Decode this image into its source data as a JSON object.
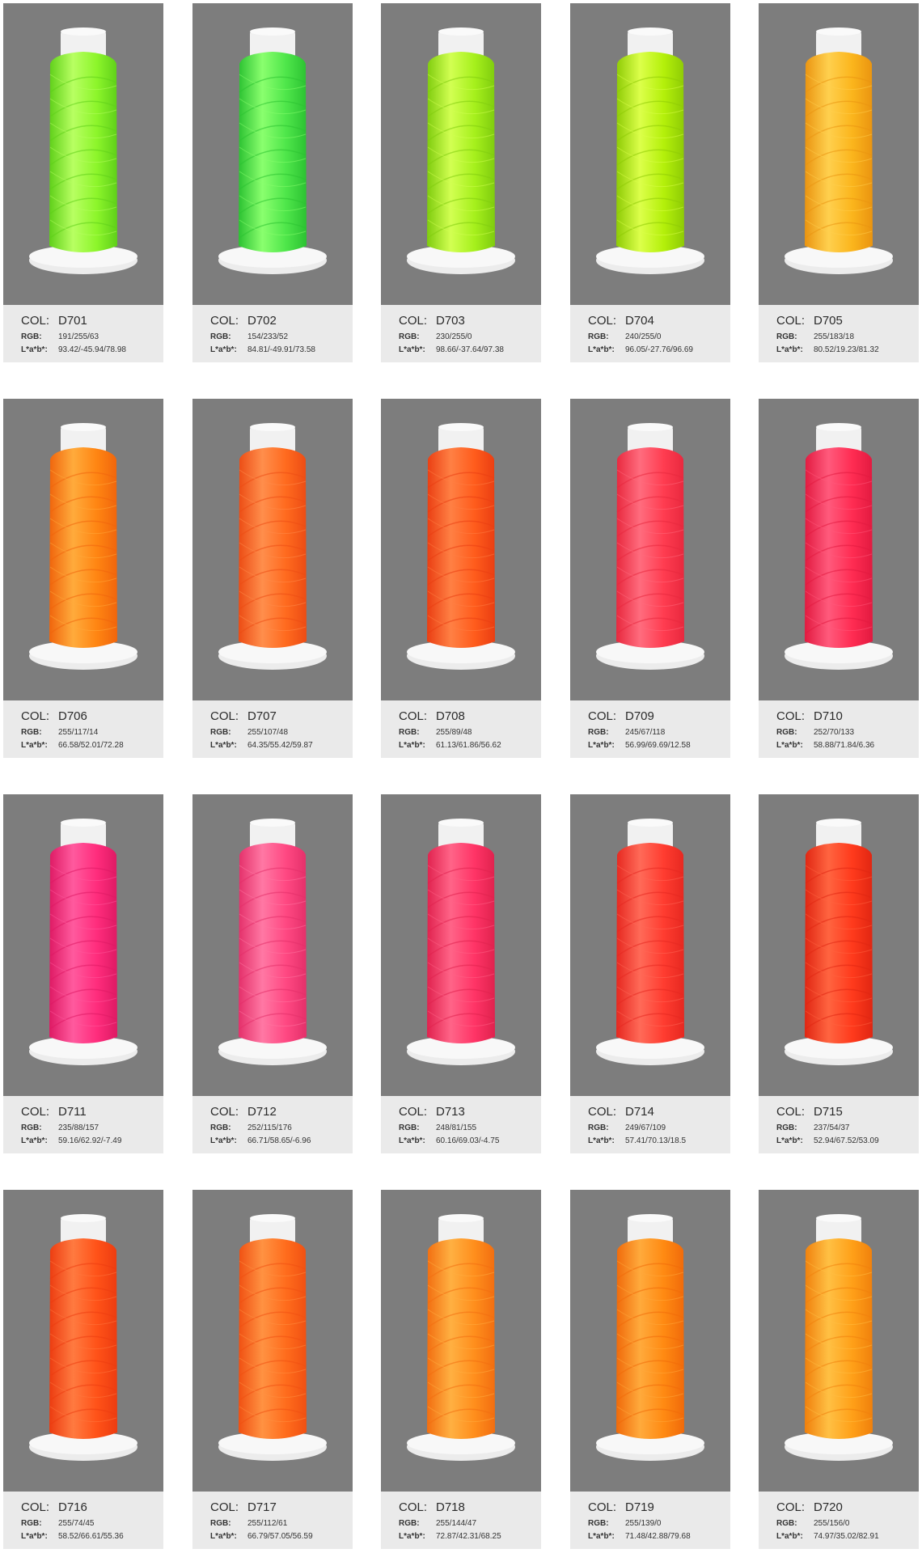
{
  "labels": {
    "col": "COL:",
    "rgb": "RGB:",
    "lab": "L*a*b*:"
  },
  "swatches": [
    {
      "code": "D701",
      "rgb": "191/255/63",
      "lab": "93.42/-45.94/78.98",
      "color": "#8cf52a",
      "shade": "#5fd019",
      "light": "#b8ff62"
    },
    {
      "code": "D702",
      "rgb": "154/233/52",
      "lab": "84.81/-49.91/73.58",
      "color": "#4ee64a",
      "shade": "#2cc232",
      "light": "#8aff6e"
    },
    {
      "code": "D703",
      "rgb": "230/255/0",
      "lab": "98.66/-37.64/97.38",
      "color": "#a6f01c",
      "shade": "#7fcc0e",
      "light": "#d2ff52"
    },
    {
      "code": "D704",
      "rgb": "240/255/0",
      "lab": "96.05/-27.76/96.69",
      "color": "#b4f00a",
      "shade": "#8ecb05",
      "light": "#dcff4a"
    },
    {
      "code": "D705",
      "rgb": "255/183/18",
      "lab": "80.52/19.23/81.32",
      "color": "#fbb51c",
      "shade": "#ea9410",
      "light": "#ffd04e"
    },
    {
      "code": "D706",
      "rgb": "255/117/14",
      "lab": "66.58/52.01/72.28",
      "color": "#ff8512",
      "shade": "#f0650c",
      "light": "#ffab3c"
    },
    {
      "code": "D707",
      "rgb": "255/107/48",
      "lab": "64.35/55.42/59.87",
      "color": "#ff6a1e",
      "shade": "#ec4c14",
      "light": "#ff8e4c"
    },
    {
      "code": "D708",
      "rgb": "255/89/48",
      "lab": "61.13/61.86/56.62",
      "color": "#ff5c1c",
      "shade": "#ea3e12",
      "light": "#ff8044"
    },
    {
      "code": "D709",
      "rgb": "245/67/118",
      "lab": "56.99/69.69/12.58",
      "color": "#ff3c50",
      "shade": "#e8283e",
      "light": "#ff6c7e"
    },
    {
      "code": "D710",
      "rgb": "252/70/133",
      "lab": "58.88/71.84/6.36",
      "color": "#ff2c52",
      "shade": "#e21a40",
      "light": "#ff5a7c"
    },
    {
      "code": "D711",
      "rgb": "235/88/157",
      "lab": "59.16/62.92/-7.49",
      "color": "#ff2c7c",
      "shade": "#de1a64",
      "light": "#ff5a9e"
    },
    {
      "code": "D712",
      "rgb": "252/115/176",
      "lab": "66.71/58.65/-6.96",
      "color": "#ff4882",
      "shade": "#e4306a",
      "light": "#ff78a4"
    },
    {
      "code": "D713",
      "rgb": "248/81/155",
      "lab": "60.16/69.03/-4.75",
      "color": "#ff3466",
      "shade": "#e0224e",
      "light": "#ff6488"
    },
    {
      "code": "D714",
      "rgb": "249/67/109",
      "lab": "57.41/70.13/18.5",
      "color": "#ff3c30",
      "shade": "#e62820",
      "light": "#ff6a58"
    },
    {
      "code": "D715",
      "rgb": "237/54/37",
      "lab": "52.94/67.52/53.09",
      "color": "#ff3a1c",
      "shade": "#e02612",
      "light": "#ff6440"
    },
    {
      "code": "D716",
      "rgb": "255/74/45",
      "lab": "58.52/66.61/55.36",
      "color": "#ff5218",
      "shade": "#ec3c10",
      "light": "#ff7a40"
    },
    {
      "code": "D717",
      "rgb": "255/112/61",
      "lab": "66.79/57.05/56.59",
      "color": "#ff6c1c",
      "shade": "#f05012",
      "light": "#ff9242"
    },
    {
      "code": "D718",
      "rgb": "255/144/47",
      "lab": "72.87/42.31/68.25",
      "color": "#ff8e1c",
      "shade": "#f26e10",
      "light": "#ffb042"
    },
    {
      "code": "D719",
      "rgb": "255/139/0",
      "lab": "71.48/42.88/79.68",
      "color": "#ff8a12",
      "shade": "#f06a0a",
      "light": "#ffaa3c"
    },
    {
      "code": "D720",
      "rgb": "255/156/0",
      "lab": "74.97/35.02/82.91",
      "color": "#ffa018",
      "shade": "#f0800c",
      "light": "#ffc044"
    }
  ]
}
